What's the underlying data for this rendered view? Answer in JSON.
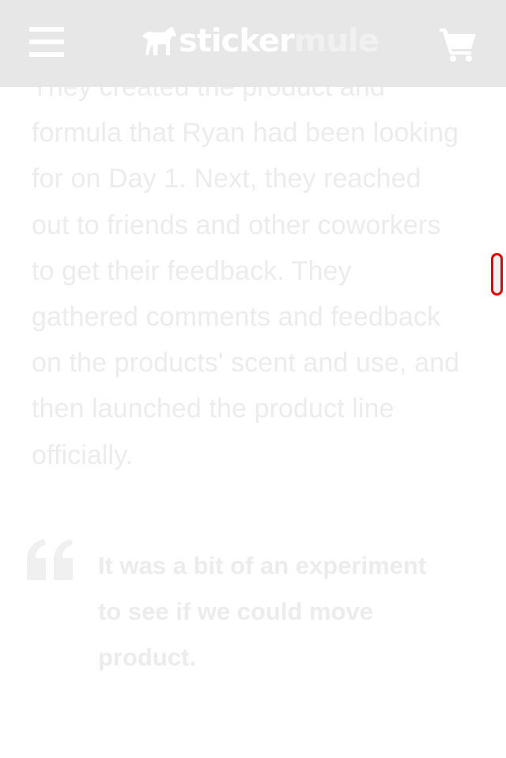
{
  "header": {
    "logo": {
      "part1": "sticker",
      "part2": "mule"
    },
    "menu_icon": "hamburger-menu-icon",
    "cart_icon": "shopping-cart-icon",
    "background": "#e7e7e7"
  },
  "article": {
    "paragraph": "They created the product and formula that Ryan had been looking for on Day 1. Next, they reached out to friends and other coworkers to get their feedback. They gathered comments and feedback on the products' scent and use, and then launched the product line officially.",
    "text_color": "#ececec"
  },
  "quote": {
    "icon": "quote-mark-icon",
    "text": "It was a bit of an experiment to see if we could move product."
  },
  "scroll_indicator": {
    "border_color": "#ee0000"
  }
}
